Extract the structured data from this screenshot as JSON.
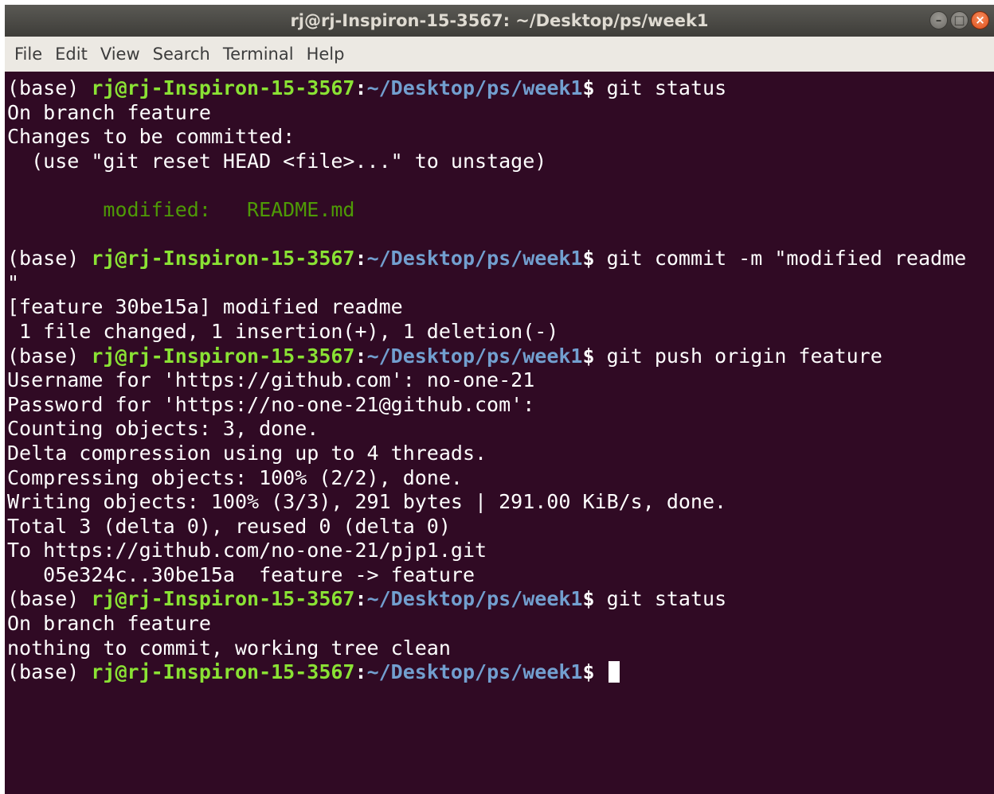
{
  "window": {
    "title": "rj@rj-Inspiron-15-3567: ~/Desktop/ps/week1",
    "controls": {
      "minimize": "–",
      "maximize": "□",
      "close": "×"
    }
  },
  "menu": [
    "File",
    "Edit",
    "View",
    "Search",
    "Terminal",
    "Help"
  ],
  "prompt": {
    "env": "(base) ",
    "user_host": "rj@rj-Inspiron-15-3567",
    "colon": ":",
    "path": "~/Desktop/ps/week1",
    "symbol": "$ "
  },
  "colors": {
    "background": "#300a24",
    "prompt_user": "#8ae234",
    "prompt_path": "#729fcf",
    "staged_file": "#4e9a06"
  },
  "lines": [
    {
      "type": "prompt",
      "cmd": "git status"
    },
    {
      "type": "text",
      "text": "On branch feature"
    },
    {
      "type": "text",
      "text": "Changes to be committed:"
    },
    {
      "type": "text",
      "text": "  (use \"git reset HEAD <file>...\" to unstage)"
    },
    {
      "type": "text",
      "text": ""
    },
    {
      "type": "staged",
      "text": "        modified:   README.md"
    },
    {
      "type": "text",
      "text": ""
    },
    {
      "type": "prompt",
      "cmd": "git commit -m \"modified readme"
    },
    {
      "type": "text",
      "text": "\""
    },
    {
      "type": "text",
      "text": "[feature 30be15a] modified readme"
    },
    {
      "type": "text",
      "text": " 1 file changed, 1 insertion(+), 1 deletion(-)"
    },
    {
      "type": "prompt",
      "cmd": "git push origin feature"
    },
    {
      "type": "text",
      "text": "Username for 'https://github.com': no-one-21"
    },
    {
      "type": "text",
      "text": "Password for 'https://no-one-21@github.com':"
    },
    {
      "type": "text",
      "text": "Counting objects: 3, done."
    },
    {
      "type": "text",
      "text": "Delta compression using up to 4 threads."
    },
    {
      "type": "text",
      "text": "Compressing objects: 100% (2/2), done."
    },
    {
      "type": "text",
      "text": "Writing objects: 100% (3/3), 291 bytes | 291.00 KiB/s, done."
    },
    {
      "type": "text",
      "text": "Total 3 (delta 0), reused 0 (delta 0)"
    },
    {
      "type": "text",
      "text": "To https://github.com/no-one-21/pjp1.git"
    },
    {
      "type": "text",
      "text": "   05e324c..30be15a  feature -> feature"
    },
    {
      "type": "prompt",
      "cmd": "git status"
    },
    {
      "type": "text",
      "text": "On branch feature"
    },
    {
      "type": "text",
      "text": "nothing to commit, working tree clean"
    },
    {
      "type": "prompt",
      "cmd": "",
      "cursor": true
    }
  ]
}
